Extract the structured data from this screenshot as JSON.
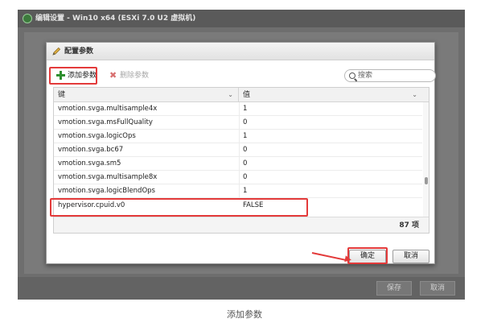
{
  "outer_dialog": {
    "title": "编辑设置 - Win10 x64 (ESXi 7.0 U2 虚拟机)",
    "save_label": "保存",
    "cancel_label": "取消"
  },
  "dialog": {
    "title": "配置参数",
    "add_label": "添加参数",
    "delete_label": "删除参数",
    "search_placeholder": "搜索",
    "columns": {
      "key": "键",
      "value": "值"
    },
    "rows": [
      {
        "key": "vmotion.svga.multisample4x",
        "value": "1"
      },
      {
        "key": "vmotion.svga.msFullQuality",
        "value": "0"
      },
      {
        "key": "vmotion.svga.logicOps",
        "value": "1"
      },
      {
        "key": "vmotion.svga.bc67",
        "value": "0"
      },
      {
        "key": "vmotion.svga.sm5",
        "value": "0"
      },
      {
        "key": "vmotion.svga.multisample8x",
        "value": "0"
      },
      {
        "key": "vmotion.svga.logicBlendOps",
        "value": "1"
      },
      {
        "key": "hypervisor.cpuid.v0",
        "value": "FALSE"
      }
    ],
    "item_count": "87 项",
    "ok_label": "确定",
    "cancel_label": "取消"
  },
  "caption": "添加参数",
  "colors": {
    "annotation": "#e33a3a",
    "add_icon": "#2f8f2f"
  }
}
